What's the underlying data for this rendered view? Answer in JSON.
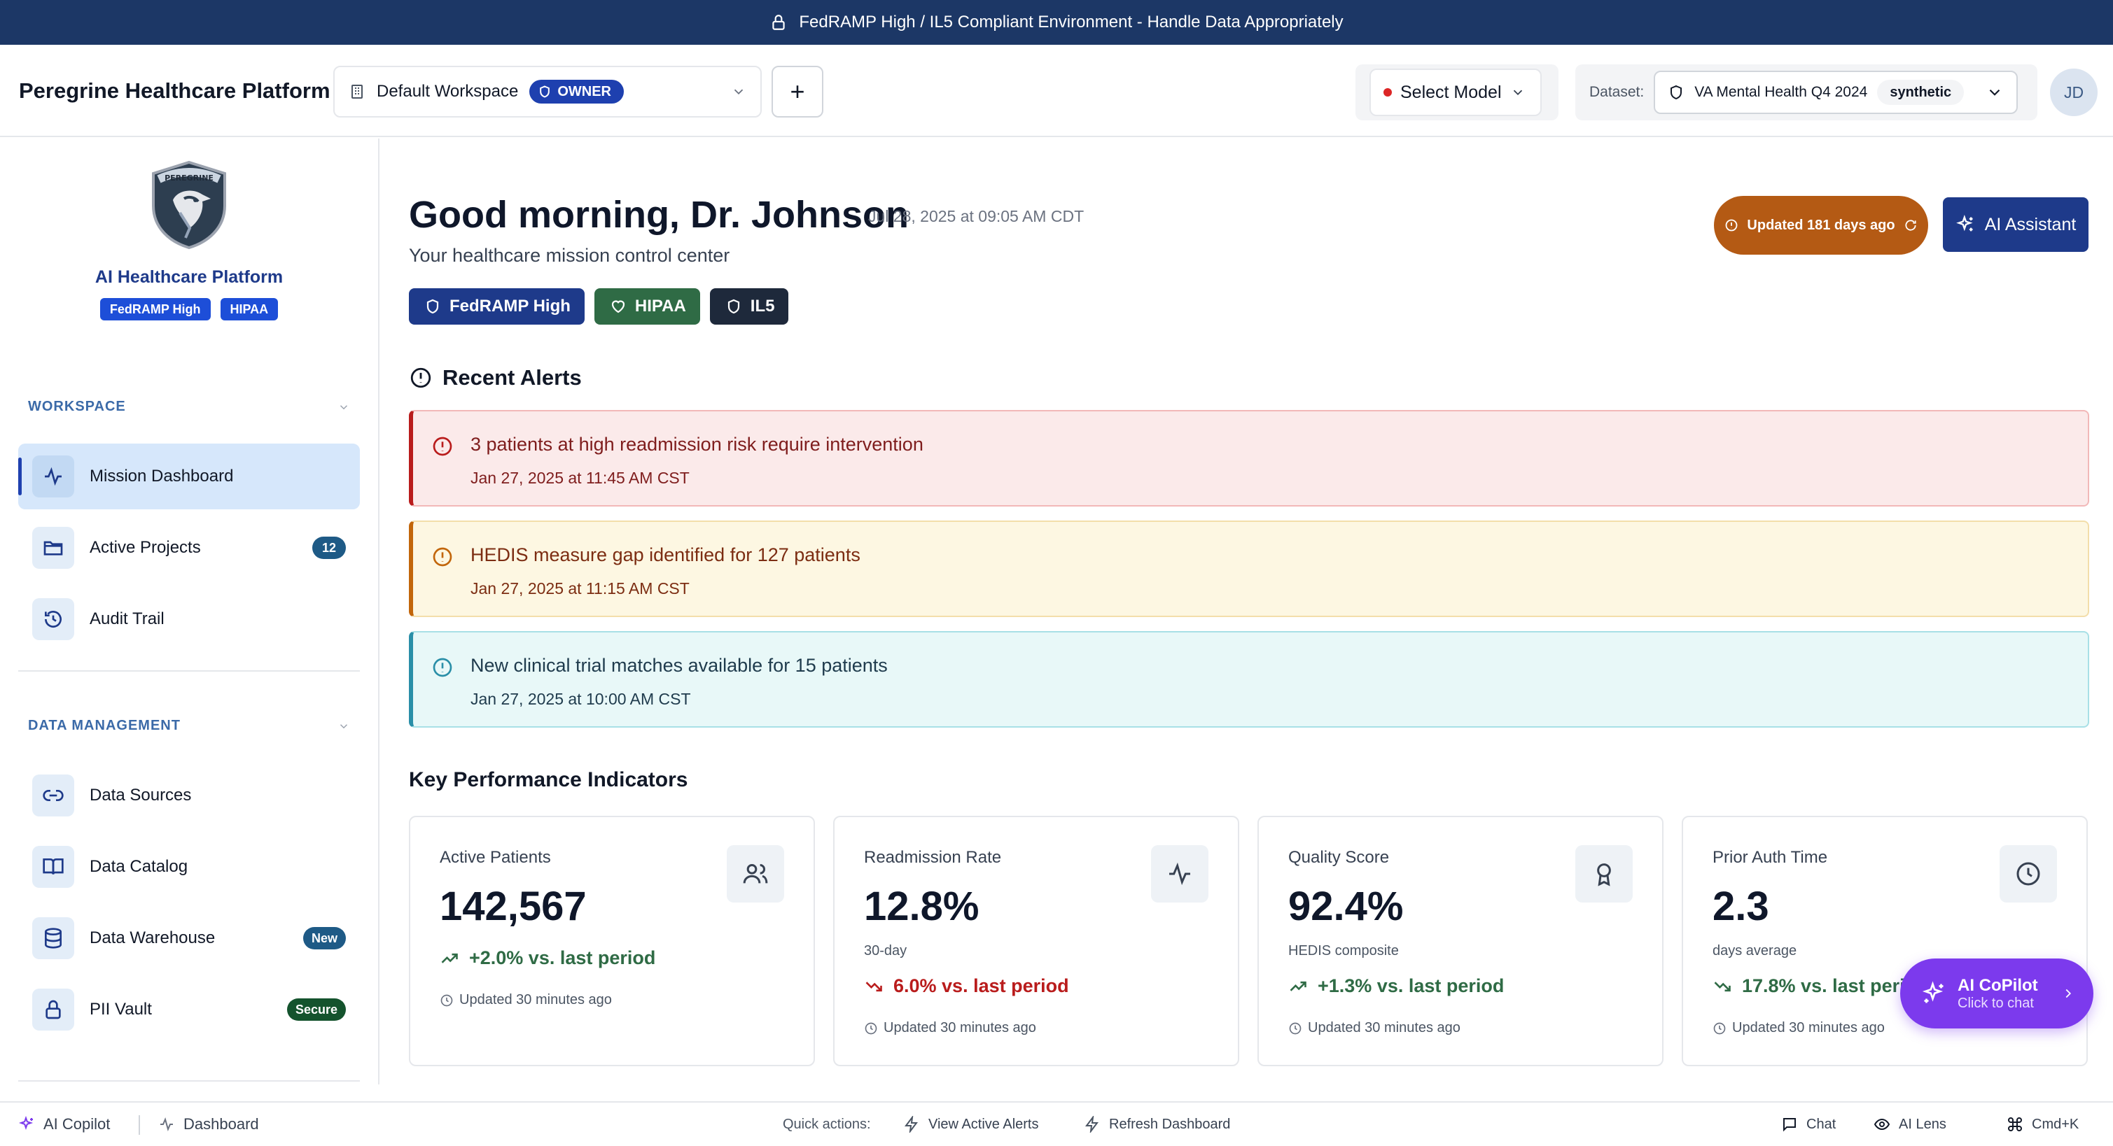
{
  "banner": {
    "text": "FedRAMP High / IL5 Compliant Environment - Handle Data Appropriately"
  },
  "header": {
    "brand": "Peregrine Healthcare Platform",
    "workspace": {
      "name": "Default Workspace",
      "role": "OWNER"
    },
    "add_label": "+",
    "model": {
      "label": "Select Model",
      "status_color": "#dc2626"
    },
    "dataset": {
      "label": "Dataset:",
      "name": "VA Mental Health Q4 2024",
      "tag": "synthetic"
    },
    "avatar_initials": "JD"
  },
  "sidebar": {
    "logo_text": "PEREGRINE",
    "title": "AI Healthcare Platform",
    "badges": [
      "FedRAMP High",
      "HIPAA"
    ],
    "sections": [
      {
        "title": "WORKSPACE",
        "items": [
          {
            "label": "Mission Dashboard",
            "icon": "activity-icon",
            "active": true
          },
          {
            "label": "Active Projects",
            "icon": "folder-icon",
            "count": "12"
          },
          {
            "label": "Audit Trail",
            "icon": "history-icon"
          }
        ]
      },
      {
        "title": "DATA MANAGEMENT",
        "items": [
          {
            "label": "Data Sources",
            "icon": "link-icon"
          },
          {
            "label": "Data Catalog",
            "icon": "book-icon"
          },
          {
            "label": "Data Warehouse",
            "icon": "database-icon",
            "count": "New"
          },
          {
            "label": "PII Vault",
            "icon": "lock-icon",
            "count": "Secure"
          }
        ]
      }
    ]
  },
  "main": {
    "greeting": "Good morning, Dr. Johnson",
    "date": "Jul 28, 2025 at 09:05 AM CDT",
    "subtitle": "Your healthcare mission control center",
    "compliance_badges": [
      "FedRAMP High",
      "HIPAA",
      "IL5"
    ],
    "updated": "Updated 181 days ago",
    "ai_assistant": "AI Assistant",
    "alerts_title": "Recent Alerts",
    "alerts": [
      {
        "text": "3 patients at high readmission risk require intervention",
        "time": "Jan 27, 2025 at 11:45 AM CST",
        "severity": "critical"
      },
      {
        "text": "HEDIS measure gap identified for 127 patients",
        "time": "Jan 27, 2025 at 11:15 AM CST",
        "severity": "warning"
      },
      {
        "text": "New clinical trial matches available for 15 patients",
        "time": "Jan 27, 2025 at 10:00 AM CST",
        "severity": "info"
      }
    ],
    "kpi_title": "Key Performance Indicators",
    "kpis": [
      {
        "title": "Active Patients",
        "value": "142,567",
        "sub": "",
        "trend": "+2.0% vs. last period",
        "direction": "up",
        "updated": "Updated 30 minutes ago",
        "icon": "users-icon"
      },
      {
        "title": "Readmission Rate",
        "value": "12.8%",
        "sub": "30-day",
        "trend": "6.0% vs. last period",
        "direction": "down",
        "updated": "Updated 30 minutes ago",
        "icon": "activity-icon"
      },
      {
        "title": "Quality Score",
        "value": "92.4%",
        "sub": "HEDIS composite",
        "trend": "+1.3% vs. last period",
        "direction": "up",
        "updated": "Updated 30 minutes ago",
        "icon": "award-icon"
      },
      {
        "title": "Prior Auth Time",
        "value": "2.3",
        "sub": "days average",
        "trend": "17.8% vs. last period",
        "direction": "up",
        "updated": "Updated 30 minutes ago",
        "icon": "clock-icon"
      }
    ],
    "copilot": {
      "title": "AI CoPilot",
      "subtitle": "Click to chat"
    }
  },
  "bottom": {
    "ai_copilot": "AI Copilot",
    "dashboard": "Dashboard",
    "quick_actions": "Quick actions:",
    "view_alerts": "View Active Alerts",
    "refresh": "Refresh Dashboard",
    "chat": "Chat",
    "ai_lens": "AI Lens",
    "shortcut": "Cmd+K"
  },
  "colors": {
    "navy": "#1c3766",
    "accent_blue": "#1e3a8a",
    "critical": "#b91c1c",
    "warning": "#c2660b",
    "info": "#2a8fa8",
    "positive": "#2f6b45",
    "copilot_purple": "#7c3aed",
    "updated_orange": "#b45a14"
  }
}
